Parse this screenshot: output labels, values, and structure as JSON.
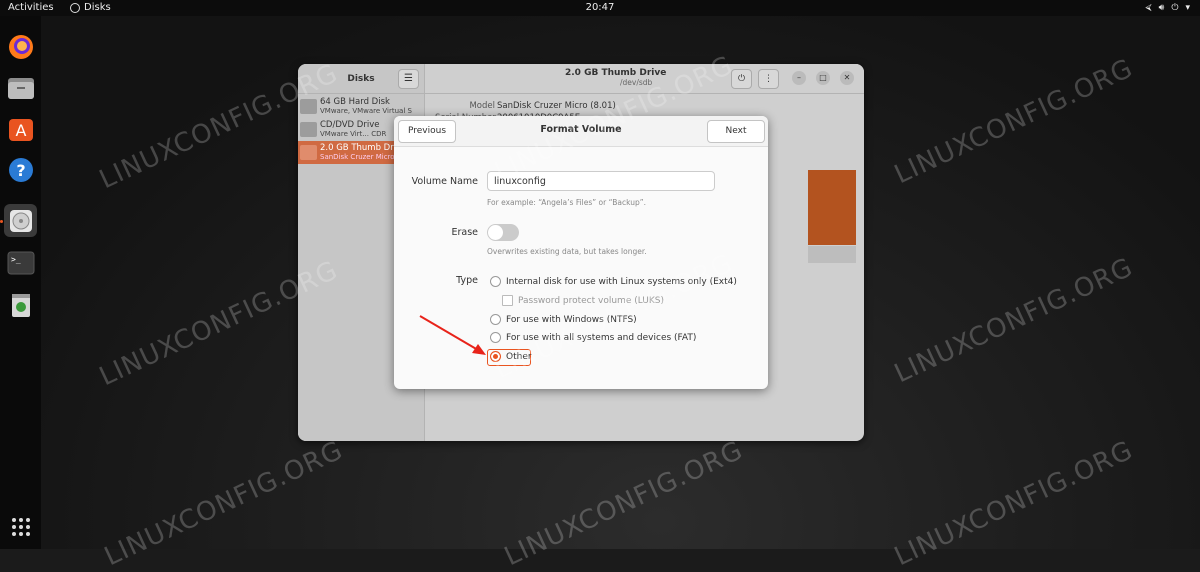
{
  "topbar": {
    "activities": "Activities",
    "app_name": "Disks",
    "clock": "20:47"
  },
  "dock": {
    "items": [
      {
        "name": "firefox",
        "active": false
      },
      {
        "name": "files",
        "active": false
      },
      {
        "name": "software",
        "active": false
      },
      {
        "name": "help",
        "active": false
      },
      {
        "name": "disks",
        "active": true
      },
      {
        "name": "terminal",
        "active": false
      },
      {
        "name": "trash",
        "active": false
      }
    ],
    "show_apps": "show-apps"
  },
  "disks_window": {
    "sidebar_title": "Disks",
    "drives": [
      {
        "name": "64 GB Hard Disk",
        "desc": "VMware, VMware Virtual S",
        "selected": false
      },
      {
        "name": "CD/DVD Drive",
        "desc": "VMware Virt...   CDR",
        "selected": false
      },
      {
        "name": "2.0 GB Thumb Drive",
        "desc": "SanDisk Cruzer Micro",
        "selected": true
      }
    ],
    "title": "2.0 GB Thumb Drive",
    "subtitle": "/dev/sdb",
    "info": {
      "model_label": "Model",
      "model_value": "SanDisk Cruzer Micro (8.01)",
      "serial_label": "Serial Number",
      "serial_value": "20061010D0C9A5E"
    }
  },
  "dialog": {
    "title": "Format Volume",
    "previous": "Previous",
    "next": "Next",
    "volume_name_label": "Volume Name",
    "volume_name_value": "linuxconfig",
    "volume_name_hint": "For example: “Angela’s Files” or “Backup”.",
    "erase_label": "Erase",
    "erase_on": false,
    "erase_hint": "Overwrites existing data, but takes longer.",
    "type_label": "Type",
    "types": [
      {
        "label": "Internal disk for use with Linux systems only (Ext4)",
        "selected": false
      },
      {
        "label": "Password protect volume (LUKS)",
        "selected": false
      },
      {
        "label": "For use with Windows (NTFS)",
        "selected": false
      },
      {
        "label": "For use with all systems and devices (FAT)",
        "selected": false
      },
      {
        "label": "Other",
        "selected": true
      }
    ]
  },
  "watermark": "LINUXCONFIG.ORG",
  "colors": {
    "accent": "#e95420",
    "selection": "#d06a42",
    "arrow": "#e8231a"
  }
}
